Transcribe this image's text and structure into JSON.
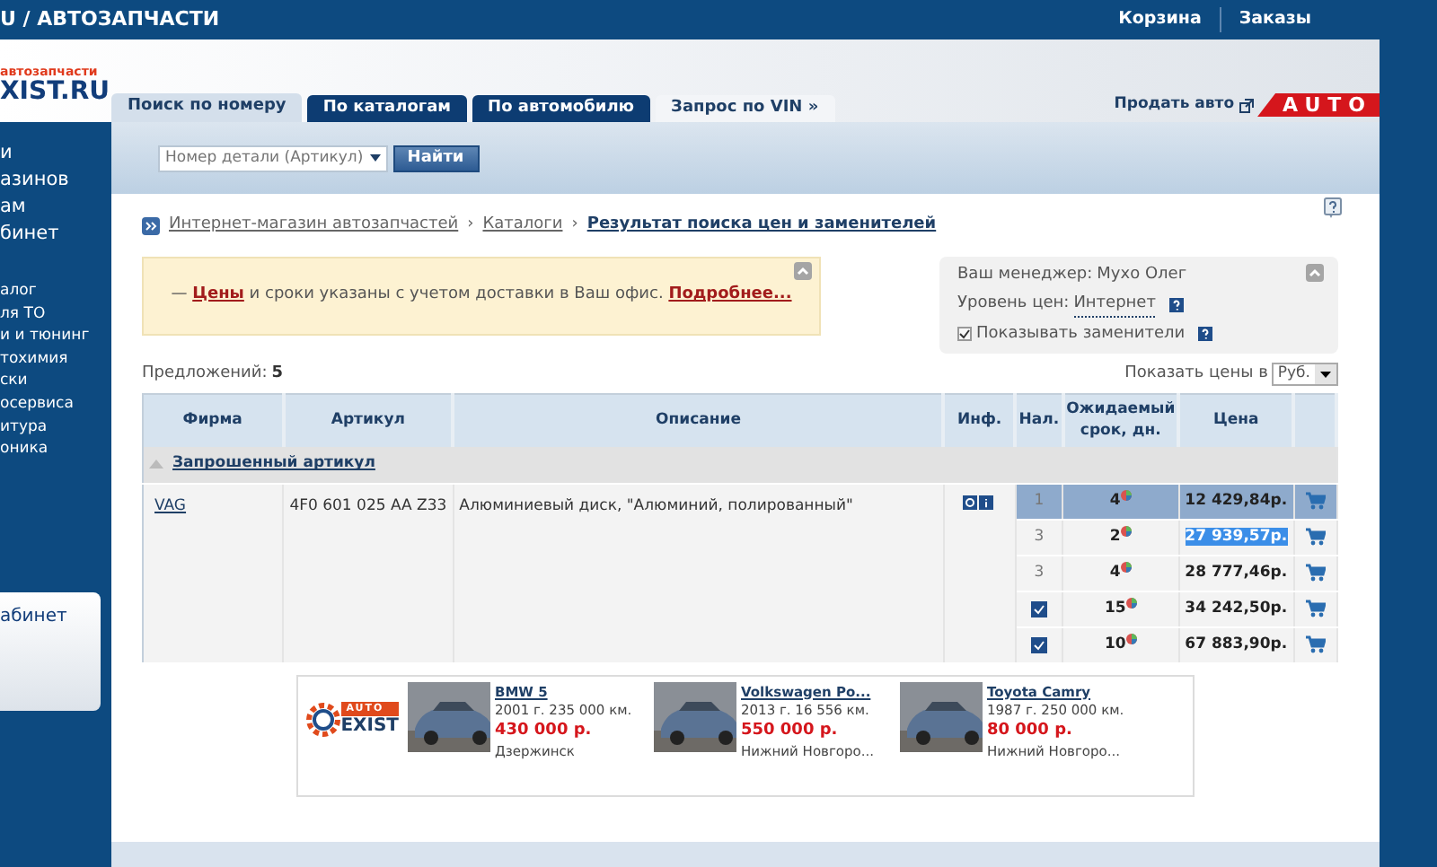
{
  "header": {
    "title": "U / АВТОЗАПЧАСТИ",
    "links": [
      "Корзина",
      "Заказы"
    ]
  },
  "logo": {
    "tagline": "автозапчасти",
    "name": "XIST.RU"
  },
  "tabs": [
    {
      "label": "Поиск по номеру",
      "kind": "tab",
      "selected": true
    },
    {
      "label": "По каталогам",
      "kind": "tab",
      "selected": false
    },
    {
      "label": "По автомобилю",
      "kind": "tab",
      "selected": false
    },
    {
      "label": "Запрос по VIN »",
      "kind": "link",
      "selected": false
    }
  ],
  "sell_auto": {
    "label": "Продать авто",
    "badge": "AUTO"
  },
  "sidebar": {
    "items": [
      "и",
      "азинов",
      "ам",
      "бинет"
    ],
    "catalog": [
      "алог",
      "ля ТО",
      "и и тюнинг",
      "тохимия",
      "ски",
      "осервиса",
      "итура",
      "оника"
    ],
    "cabinet": "абинет"
  },
  "search": {
    "placeholder": "Номер детали (Артикул)",
    "button": "Найти"
  },
  "breadcrumb_separator": "›",
  "breadcrumbs": [
    "Интернет-магазин автозапчастей",
    "Каталоги",
    "Результат поиска цен и заменителей"
  ],
  "notice": {
    "dash": "—",
    "link": "Цены",
    "text": "и сроки указаны с учетом доставки в Ваш офис.",
    "more": "Подробнее..."
  },
  "manager": {
    "label": "Ваш менеджер:",
    "name": "Мухо Олег",
    "price_label": "Уровень цен:",
    "price_level": "Интернет",
    "substitutes_label": "Показывать заменители",
    "substitutes_checked": true
  },
  "offers": {
    "label": "Предложений:",
    "count": "5"
  },
  "currency": {
    "label": "Показать цены в",
    "value": "Руб."
  },
  "table": {
    "columns": [
      "Фирма",
      "Артикул",
      "Описание",
      "Инф.",
      "Нал.",
      "Ожидаемый срок, дн.",
      "Цена"
    ],
    "group": {
      "label": "Запрошенный артикул",
      "expanded": true
    },
    "item": {
      "brand": "VAG",
      "article": "4F0 601 025 AA Z33",
      "description": "Алюминиевый диск, \"Алюминий, полированный\""
    },
    "rows": [
      {
        "kind": "count",
        "stock": "1",
        "days": "4",
        "price": "12 429,84р.",
        "selected": true,
        "text_selected": false
      },
      {
        "kind": "count",
        "stock": "3",
        "days": "2",
        "price": "27 939,57р.",
        "selected": false,
        "text_selected": true
      },
      {
        "kind": "count",
        "stock": "3",
        "days": "4",
        "price": "28 777,46р.",
        "selected": false,
        "text_selected": false
      },
      {
        "kind": "check",
        "days": "15",
        "price": "34 242,50р.",
        "selected": false,
        "text_selected": false
      },
      {
        "kind": "check",
        "days": "10",
        "price": "67 883,90р.",
        "selected": false,
        "text_selected": false
      }
    ]
  },
  "ads": {
    "logo_top": "AUTO",
    "logo_name": "EXIST",
    "cars": [
      {
        "title": "BMW 5",
        "details": "2001 г. 235 000 км.",
        "price": "430 000 р.",
        "city": "Дзержинск"
      },
      {
        "title": "Volkswagen Po...",
        "details": "2013 г. 16 556 км.",
        "price": "550 000 р.",
        "city": "Нижний Новгоро..."
      },
      {
        "title": "Toyota Camry",
        "details": "1987 г. 250 000 км.",
        "price": "80 000 р.",
        "city": "Нижний Новгоро..."
      }
    ]
  }
}
